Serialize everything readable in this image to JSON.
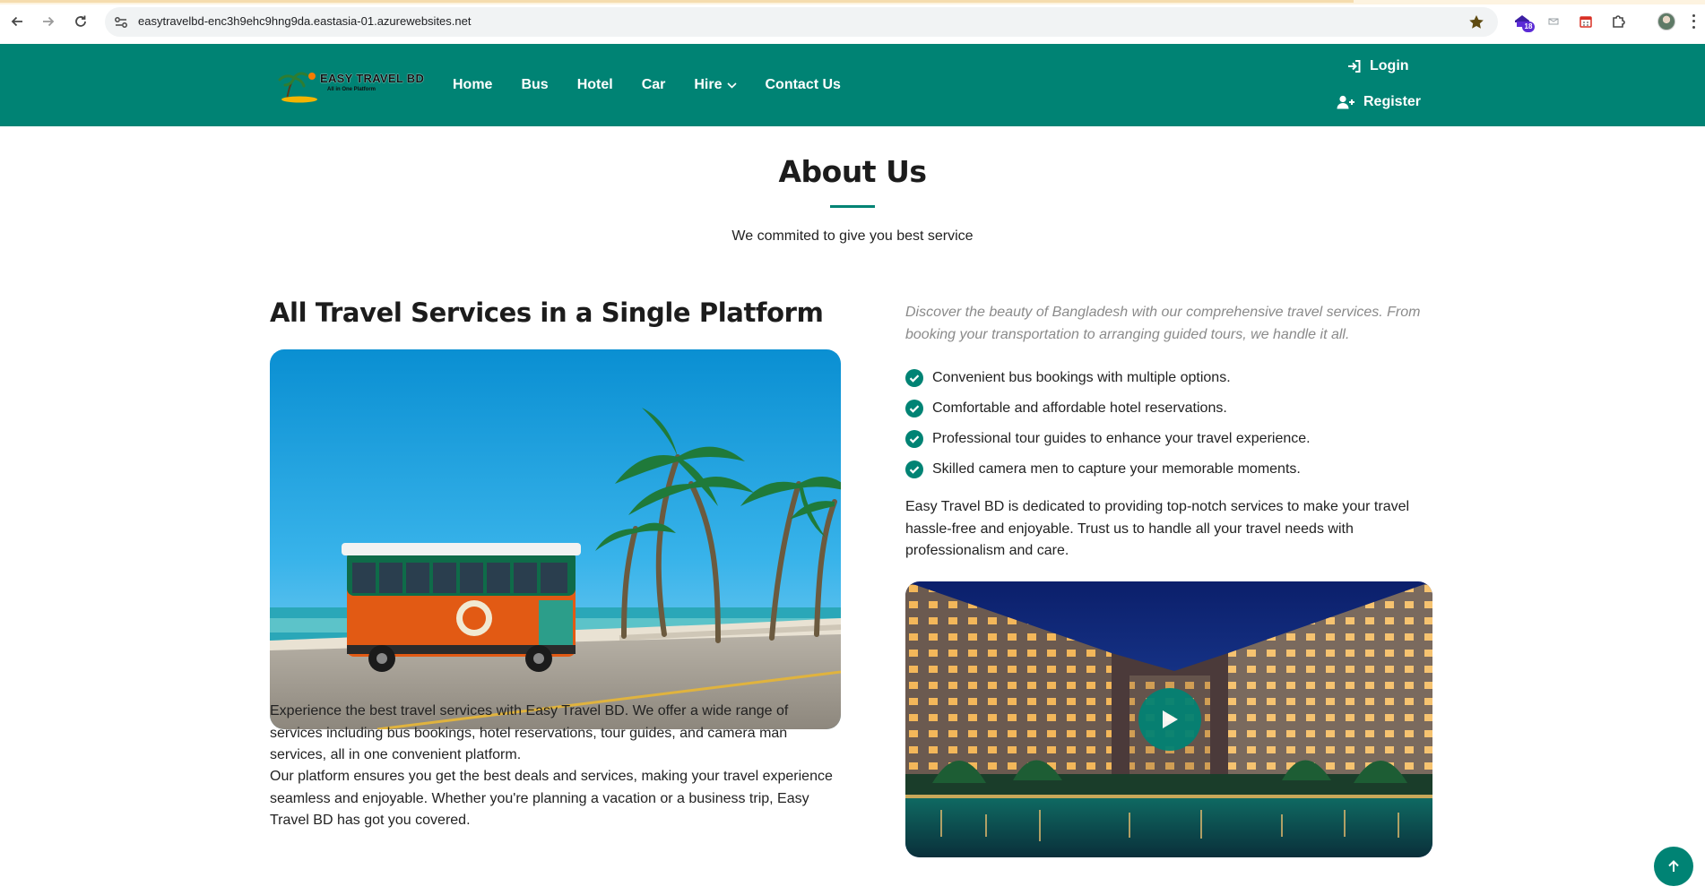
{
  "browser": {
    "url": "easytravelbd-enc3h9ehc9hng9da.eastasia-01.azurewebsites.net",
    "extension_badge": "18",
    "icons": [
      "back-icon",
      "forward-icon",
      "reload-icon",
      "site-info-icon",
      "bookmark-star-icon",
      "extension-icon",
      "calendar-icon",
      "puzzle-icon",
      "profile-avatar",
      "menu-icon"
    ]
  },
  "header": {
    "logo": {
      "title": "EASY TRAVEL BD",
      "tagline": "All in One Platform"
    },
    "nav": [
      {
        "label": "Home"
      },
      {
        "label": "Bus"
      },
      {
        "label": "Hotel"
      },
      {
        "label": "Car"
      },
      {
        "label": "Hire"
      },
      {
        "label": "Contact Us"
      }
    ],
    "login_label": "Login",
    "register_label": "Register"
  },
  "about": {
    "title": "About Us",
    "subtitle": "We commited to give you best service",
    "heading": "All Travel Services in a Single Platform",
    "left_paragraph_1": "Experience the best travel services with Easy Travel BD. We offer a wide range of services including bus bookings, hotel reservations, tour guides, and camera man services, all in one convenient platform.",
    "left_paragraph_2": "Our platform ensures you get the best deals and services, making your travel experience seamless and enjoyable. Whether you're planning a vacation or a business trip, Easy Travel BD has got you covered.",
    "intro": "Discover the beauty of Bangladesh with our comprehensive travel services. From booking your transportation to arranging guided tours, we handle it all.",
    "features": [
      "Convenient bus bookings with multiple options.",
      "Comfortable and affordable hotel reservations.",
      "Professional tour guides to enhance your travel experience.",
      "Skilled camera men to capture your memorable moments."
    ],
    "right_paragraph": "Easy Travel BD is dedicated to providing top-notch services to make your travel hassle-free and enjoyable. Trust us to handle all your travel needs with professionalism and care."
  },
  "colors": {
    "brand": "#008374",
    "text": "#222222",
    "muted": "#8a8a8a"
  }
}
